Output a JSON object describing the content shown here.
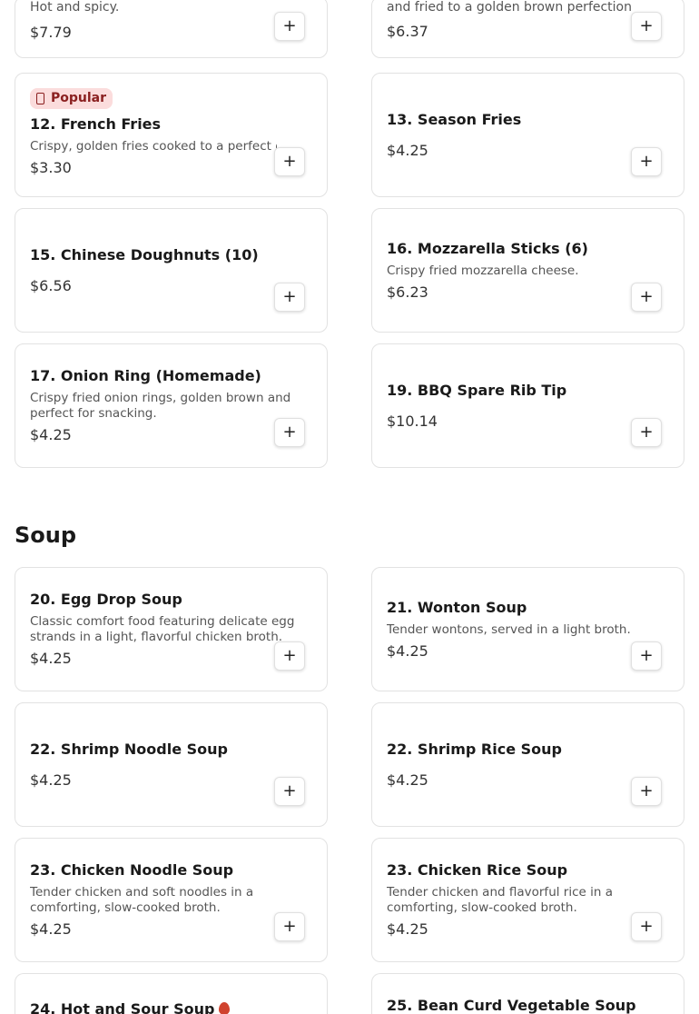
{
  "add_label": "+",
  "top_row": [
    {
      "desc": "Hot and spicy.",
      "price": "$7.79"
    },
    {
      "desc": "and fried to a golden brown perfection",
      "price": "$6.37"
    }
  ],
  "items": [
    {
      "badge": "Popular",
      "name": "12. French Fries",
      "desc": "Crispy, golden fries cooked to a perfect crisp.",
      "price": "$3.30"
    },
    {
      "name": "13. Season Fries",
      "price": "$4.25"
    },
    {
      "name": "15. Chinese Doughnuts (10)",
      "price": "$6.56"
    },
    {
      "name": "16. Mozzarella Sticks (6)",
      "desc": "Crispy fried mozzarella cheese.",
      "price": "$6.23"
    },
    {
      "name": "17. Onion Ring (Homemade)",
      "desc": "Crispy fried onion rings, golden brown and perfect for snacking.",
      "price": "$4.25"
    },
    {
      "name": "19. BBQ Spare Rib Tip",
      "price": "$10.14"
    }
  ],
  "soup_section": {
    "title": "Soup",
    "items": [
      {
        "name": "20. Egg Drop Soup",
        "desc": "Classic comfort food featuring delicate egg strands in a light, flavorful chicken broth.",
        "price": "$4.25"
      },
      {
        "name": "21. Wonton Soup",
        "desc": "Tender wontons, served in a light broth.",
        "price": "$4.25"
      },
      {
        "name": "22. Shrimp Noodle Soup",
        "price": "$4.25"
      },
      {
        "name": "22. Shrimp Rice Soup",
        "price": "$4.25"
      },
      {
        "name": "23. Chicken Noodle Soup",
        "desc": "Tender chicken and soft noodles in a comforting, slow-cooked broth.",
        "price": "$4.25"
      },
      {
        "name": "23. Chicken Rice Soup",
        "desc": "Tender chicken and flavorful rice in a comforting, slow-cooked broth.",
        "price": "$4.25"
      },
      {
        "name": "24. Hot and Sour Soup",
        "spicy_icon": "chili-pepper-icon"
      },
      {
        "name": "25. Bean Curd Vegetable Soup"
      }
    ]
  }
}
